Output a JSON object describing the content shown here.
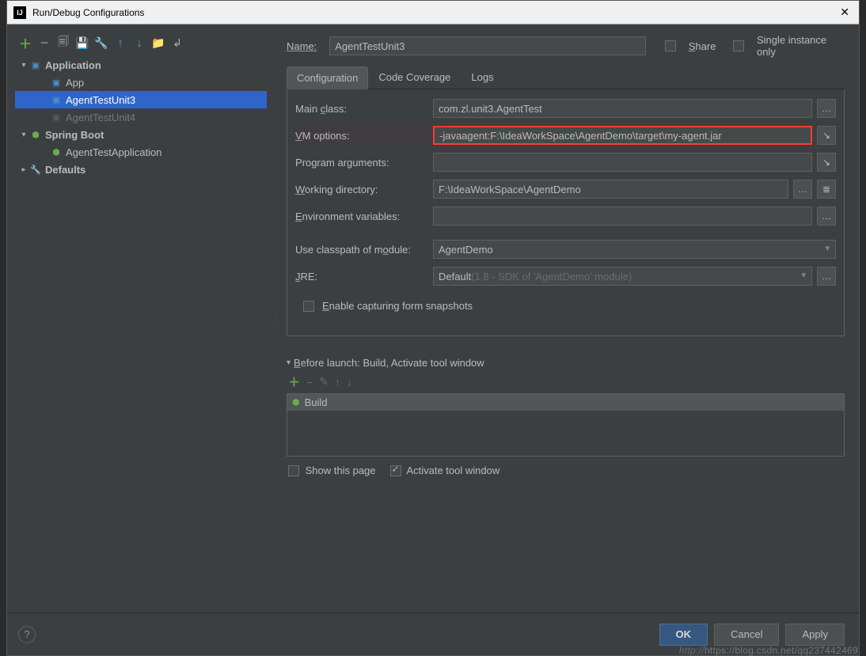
{
  "titlebar": {
    "title": "Run/Debug Configurations"
  },
  "sidebar": {
    "nodes": [
      {
        "label": "Application",
        "kind": "group"
      },
      {
        "label": "App",
        "kind": "app"
      },
      {
        "label": "AgentTestUnit3",
        "kind": "app",
        "selected": true
      },
      {
        "label": "AgentTestUnit4",
        "kind": "app",
        "dim": true
      },
      {
        "label": "Spring Boot",
        "kind": "group"
      },
      {
        "label": "AgentTestApplication",
        "kind": "sboot"
      },
      {
        "label": "Defaults",
        "kind": "group-def"
      }
    ]
  },
  "head": {
    "name_label": "Name:",
    "name_value": "AgentTestUnit3",
    "share_label": "Share",
    "single_label": "Single instance only"
  },
  "tabs": {
    "items": [
      "Configuration",
      "Code Coverage",
      "Logs"
    ],
    "active": 0
  },
  "config": {
    "main_class_label": "Main class:",
    "main_class_value": "com.zl.unit3.AgentTest",
    "vm_label": "VM options:",
    "vm_value": "-javaagent:F:\\IdeaWorkSpace\\AgentDemo\\target\\my-agent.jar",
    "prog_args_label": "Program arguments:",
    "prog_args_value": "",
    "workdir_label": "Working directory:",
    "workdir_value": "F:\\IdeaWorkSpace\\AgentDemo",
    "env_label": "Environment variables:",
    "env_value": "",
    "classpath_label": "Use classpath of module:",
    "classpath_value": "AgentDemo",
    "jre_label": "JRE:",
    "jre_value": "Default",
    "jre_hint": " (1.8 - SDK of 'AgentDemo' module)",
    "enable_cap_label": "Enable capturing form snapshots"
  },
  "before_launch": {
    "header": "Before launch: Build, Activate tool window",
    "item": "Build",
    "show_page_label": "Show this page",
    "activate_label": "Activate tool window"
  },
  "footer": {
    "ok": "OK",
    "cancel": "Cancel",
    "apply": "Apply"
  },
  "watermark": {
    "pre": "http://",
    "url": "https://blog.csdn.net/qq237442469"
  }
}
